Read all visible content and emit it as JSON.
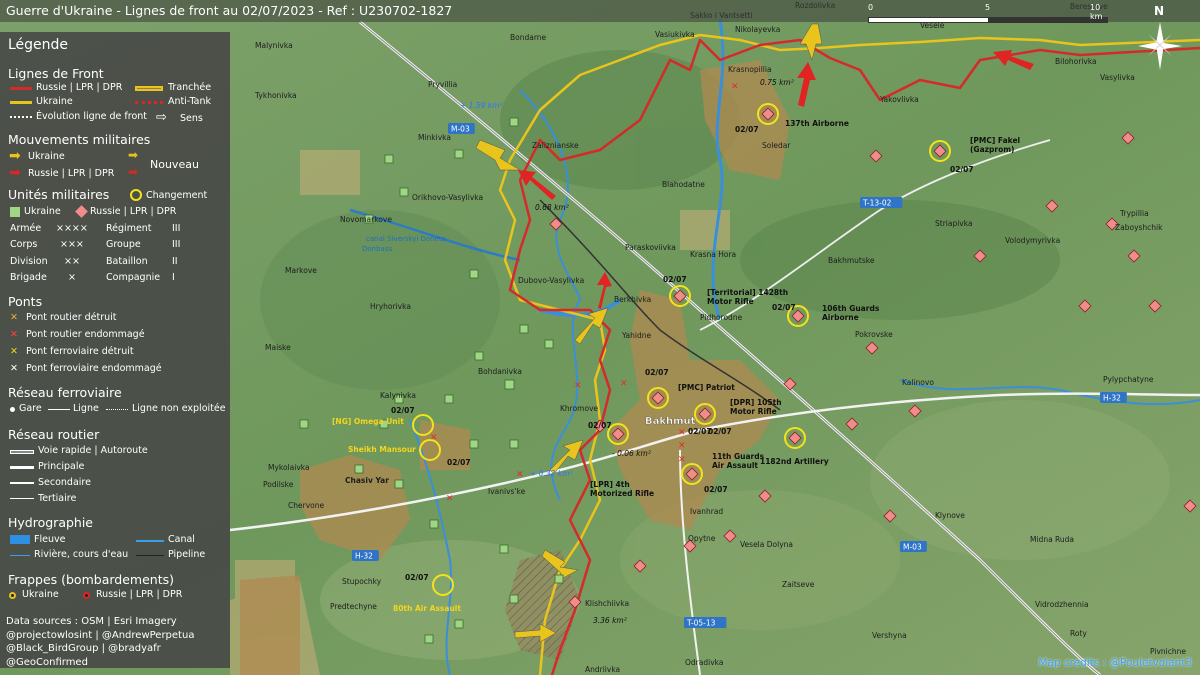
{
  "header": {
    "title": "Guerre d'Ukraine - Lignes de front au 02/07/2023 - Ref : U230702-1827",
    "scale_labels": [
      "0",
      "5",
      "10 km"
    ],
    "north": "N"
  },
  "legend": {
    "title": "Légende",
    "sections": {
      "front": "Lignes de Front",
      "movements": "Mouvements militaires",
      "units": "Unités militaires",
      "bridges": "Ponts",
      "rail": "Réseau ferroviaire",
      "road": "Réseau routier",
      "hydro": "Hydrographie",
      "strikes": "Frappes (bombardements)"
    },
    "front_items": [
      "Russie | LPR | DPR",
      "Ukraine",
      "Tranchée",
      "Anti-Tank",
      "Évolution ligne de front",
      "Sens"
    ],
    "movement_items": [
      "Ukraine",
      "Russie | LPR | DPR",
      "Nouveau"
    ],
    "unit_items": [
      "Changement",
      "Ukraine",
      "Russie | LPR | DPR"
    ],
    "echelons": [
      {
        "name": "Armée",
        "sym": "××××"
      },
      {
        "name": "Corps",
        "sym": "×××"
      },
      {
        "name": "Division",
        "sym": "××"
      },
      {
        "name": "Brigade",
        "sym": "×"
      },
      {
        "name": "Régiment",
        "sym": "III"
      },
      {
        "name": "Groupe",
        "sym": "III"
      },
      {
        "name": "Bataillon",
        "sym": "II"
      },
      {
        "name": "Compagnie",
        "sym": "I"
      }
    ],
    "bridge_items": [
      "Pont routier détruit",
      "Pont routier endommagé",
      "Pont ferroviaire détruit",
      "Pont ferroviaire endommagé"
    ],
    "rail_items": [
      "Gare",
      "Ligne",
      "Ligne non exploitée"
    ],
    "road_items": [
      "Voie rapide | Autoroute",
      "Principale",
      "Secondaire",
      "Tertiaire"
    ],
    "hydro_items": [
      "Fleuve",
      "Canal",
      "Rivière, cours d'eau",
      "Pipeline"
    ],
    "strike_items": [
      "Ukraine",
      "Russie | LPR | DPR"
    ],
    "sources": [
      "Data sources : OSM | Esri Imagery",
      "@projectowlosint | @AndrewPerpetua",
      "@Black_BirdGroup | @bradyafr",
      "@GeoConfirmed"
    ]
  },
  "map": {
    "credit": "Map credits : @Pouletvolant3",
    "colors": {
      "russia": "#d42a2a",
      "ukraine": "#e8c41c",
      "water": "#3a8fd8",
      "urban": "#b08a50"
    },
    "towns": [
      {
        "name": "Malynivka"
      },
      {
        "name": "Bondarne"
      },
      {
        "name": "Vasiukivka"
      },
      {
        "name": "Sakko i Vantsetti"
      },
      {
        "name": "Nikolayevka"
      },
      {
        "name": "Rozdolivka"
      },
      {
        "name": "Vesele"
      },
      {
        "name": "Berestove"
      },
      {
        "name": "Bilohorivka"
      },
      {
        "name": "Vasylivka"
      },
      {
        "name": "Krasnopillia"
      },
      {
        "name": "Yakovlivka"
      },
      {
        "name": "Pryvillia"
      },
      {
        "name": "Tykhonivka"
      },
      {
        "name": "Minkivka"
      },
      {
        "name": "Zaliznianske"
      },
      {
        "name": "Soledar"
      },
      {
        "name": "Blahodatne"
      },
      {
        "name": "Orikhovo-Vasylivka"
      },
      {
        "name": "Novomarkove"
      },
      {
        "name": "Paraskoviivka"
      },
      {
        "name": "Krasna Hora"
      },
      {
        "name": "Striapivka"
      },
      {
        "name": "Volodymyrivka"
      },
      {
        "name": "Trypillia"
      },
      {
        "name": "Zaboyshchik"
      },
      {
        "name": "Bakhmutske"
      },
      {
        "name": "Markove"
      },
      {
        "name": "Dubovo-Vasylivka"
      },
      {
        "name": "Berkhivka"
      },
      {
        "name": "Hryhorivka"
      },
      {
        "name": "Yahidne"
      },
      {
        "name": "Pidhorodne"
      },
      {
        "name": "Pokrovske"
      },
      {
        "name": "Maiske"
      },
      {
        "name": "Bohdanivka"
      },
      {
        "name": "Kalynivka"
      },
      {
        "name": "Khromove"
      },
      {
        "name": "Bakhmut"
      },
      {
        "name": "Kalinovo"
      },
      {
        "name": "Pylypchatyne"
      },
      {
        "name": "Mykolaivka"
      },
      {
        "name": "Chasiv Yar"
      },
      {
        "name": "Ivanivs'ke"
      },
      {
        "name": "Podilske"
      },
      {
        "name": "Chervone"
      },
      {
        "name": "Ivanhrad"
      },
      {
        "name": "Opytne"
      },
      {
        "name": "Vesela Dolyna"
      },
      {
        "name": "Klynove"
      },
      {
        "name": "Midna Ruda"
      },
      {
        "name": "Stupochky"
      },
      {
        "name": "Predtechyne"
      },
      {
        "name": "Klishchiivka"
      },
      {
        "name": "Zaitseve"
      },
      {
        "name": "Vershyna"
      },
      {
        "name": "Vidrodzhennia"
      },
      {
        "name": "Roty"
      },
      {
        "name": "Odradivka"
      },
      {
        "name": "Andriivka"
      },
      {
        "name": "Pivnichne"
      }
    ],
    "roads": [
      {
        "name": "M-03"
      },
      {
        "name": "T-13-02"
      },
      {
        "name": "H-32"
      },
      {
        "name": "M-03"
      },
      {
        "name": "H-32"
      },
      {
        "name": "T-05-13"
      }
    ],
    "canal": "canal Siverskyi Donets - Donbass",
    "areas": [
      "+ 1.59 km²",
      "0.75 km²",
      "0.68 km²",
      "- 0.06 km²",
      "+ 0.32 km²",
      "3.36 km²"
    ],
    "units": [
      {
        "name": "137th Airborne",
        "date": "02/07"
      },
      {
        "name": "[PMC] Fakel (Gazprom)",
        "date": "02/07"
      },
      {
        "name": "[Territorial] 1428th Motor Rifle",
        "date": "02/07"
      },
      {
        "name": "106th Guards Airborne",
        "date": "02/07"
      },
      {
        "name": "[PMC] Patriot",
        "date": "02/07"
      },
      {
        "name": "[DPR] 105th Motor Rifle",
        "date": "02/07"
      },
      {
        "name": "1182nd Artillery",
        "date": "02/07"
      },
      {
        "name": "11th Guards Air Assault",
        "date": "02/07"
      },
      {
        "name": "[LPR] 4th Motorized Rifle",
        "date": "02/07"
      },
      {
        "name": "[NG] Omega Unit",
        "date": "02/07"
      },
      {
        "name": "Sheikh Mansour",
        "date": "02/07"
      },
      {
        "name": "80th Air Assault",
        "date": "02/07"
      }
    ]
  }
}
